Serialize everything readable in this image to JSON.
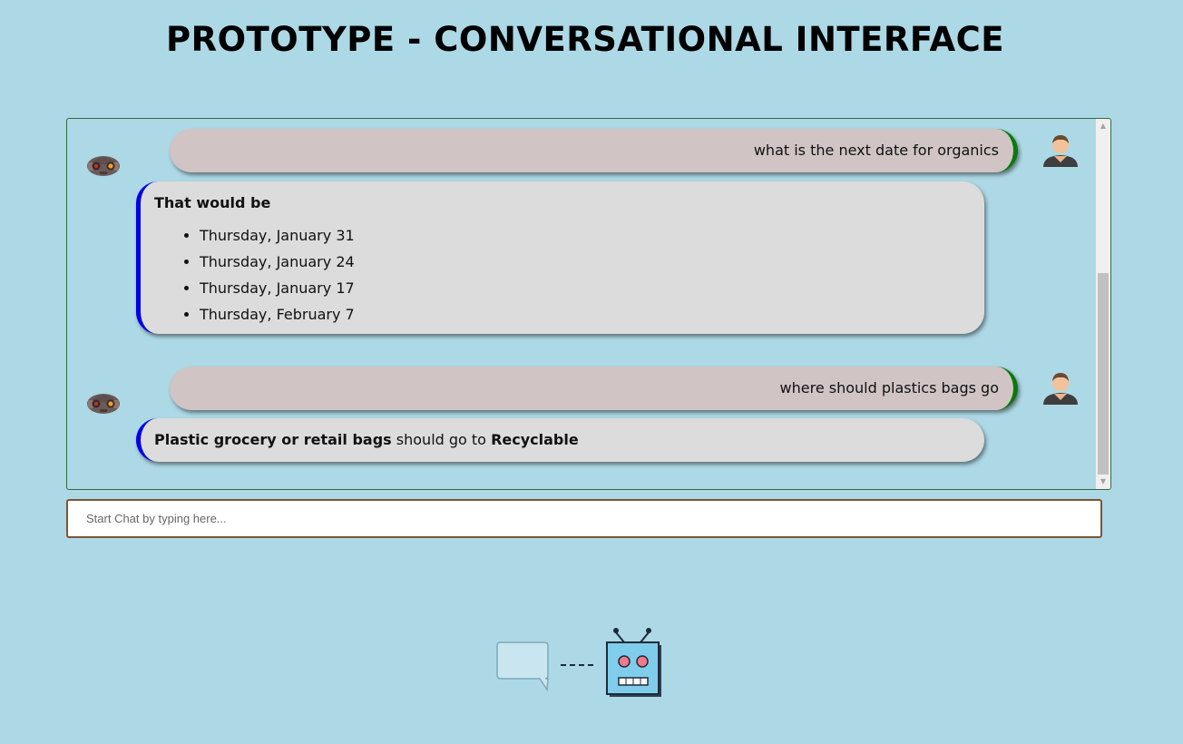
{
  "header": {
    "title": "PROTOTYPE - CONVERSATIONAL INTERFACE"
  },
  "conversation": [
    {
      "user": "what is the next date for organics",
      "bot": {
        "intro": "That would be",
        "dates": [
          "Thursday, January 31",
          "Thursday, January 24",
          "Thursday, January 17",
          "Thursday, February 7"
        ]
      }
    },
    {
      "user": "where should plastics bags go",
      "bot": {
        "item": "Plastic grocery or retail bags",
        "connector": "should go to",
        "destination": "Recyclable"
      }
    }
  ],
  "input": {
    "placeholder": "Start Chat by typing here..."
  },
  "icons": {
    "bot_avatar": "robot-head-icon",
    "user_avatar": "user-person-icon",
    "footer": "chat-to-robot-illustration"
  },
  "colors": {
    "background": "#add8e6",
    "user_bubble": "#d0c4c4",
    "user_accent": "#0a7a0a",
    "bot_bubble": "#dcdcdc",
    "bot_accent": "#0000e6",
    "input_border": "#7a5636"
  }
}
